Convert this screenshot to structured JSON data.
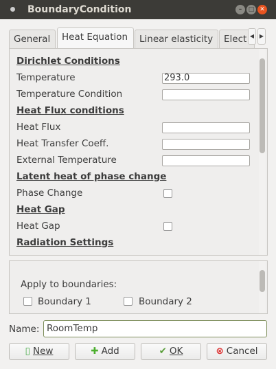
{
  "window": {
    "title": "BoundaryCondition"
  },
  "tabs": [
    "General",
    "Heat Equation",
    "Linear elasticity",
    "Elect"
  ],
  "heat": {
    "dirichlet": "Dirichlet Conditions",
    "temperature": "Temperature",
    "temperature_value": "293.0",
    "temp_condition": "Temperature Condition",
    "heat_flux_hdr": "Heat Flux conditions",
    "heat_flux": "Heat Flux",
    "htc": "Heat Transfer Coeff.",
    "ext_temp": "External Temperature",
    "latent_hdr": "Latent heat of phase change",
    "phase_change": "Phase Change",
    "heat_gap_hdr": "Heat Gap",
    "heat_gap": "Heat Gap",
    "radiation_hdr": "Radiation Settings"
  },
  "boundaries": {
    "label": "Apply to boundaries:",
    "items": [
      "Boundary 1",
      "Boundary 2"
    ]
  },
  "name": {
    "label": "Name:",
    "value": "RoomTemp"
  },
  "buttons": {
    "new": "New",
    "add": "Add",
    "ok": "OK",
    "cancel": "Cancel"
  }
}
